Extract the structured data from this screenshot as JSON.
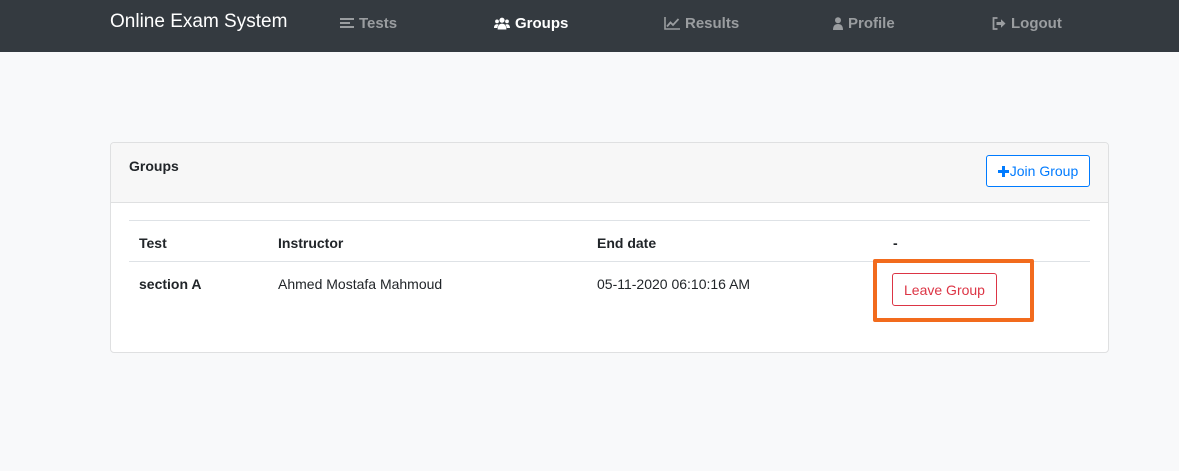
{
  "app": {
    "brand": "Online Exam System"
  },
  "nav": {
    "items": [
      {
        "label": "Tests",
        "icon": "list-icon",
        "active": false
      },
      {
        "label": "Groups",
        "icon": "users-icon",
        "active": true
      },
      {
        "label": "Results",
        "icon": "line-chart-icon",
        "active": false
      },
      {
        "label": "Profile",
        "icon": "user-icon",
        "active": false
      },
      {
        "label": "Logout",
        "icon": "sign-out-icon",
        "active": false
      }
    ]
  },
  "card": {
    "title": "Groups",
    "join_label": "Join Group"
  },
  "table": {
    "headers": [
      "Test",
      "Instructor",
      "End date",
      "-"
    ],
    "rows": [
      {
        "test": "section A",
        "instructor": "Ahmed Mostafa Mahmoud",
        "end_date": "05-11-2020 06:10:16 AM",
        "action_label": "Leave Group"
      }
    ]
  },
  "colors": {
    "navbar": "#343a40",
    "primary": "#007bff",
    "danger": "#dc3545",
    "highlight": "#f26b1d"
  }
}
